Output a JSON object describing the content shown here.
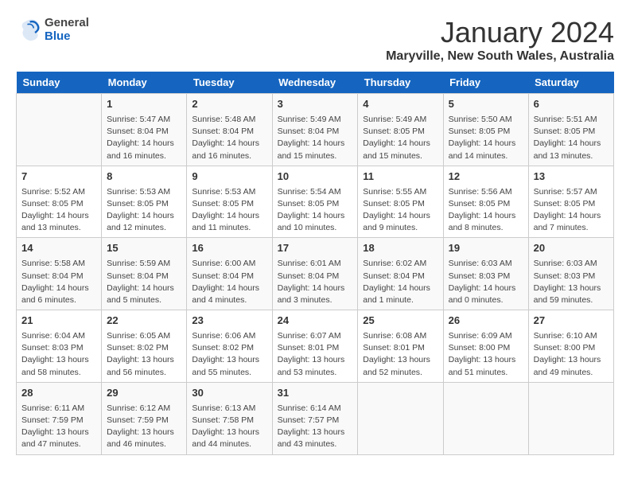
{
  "header": {
    "logo_general": "General",
    "logo_blue": "Blue",
    "month": "January 2024",
    "location": "Maryville, New South Wales, Australia"
  },
  "days_of_week": [
    "Sunday",
    "Monday",
    "Tuesday",
    "Wednesday",
    "Thursday",
    "Friday",
    "Saturday"
  ],
  "weeks": [
    [
      {
        "day": "",
        "info": ""
      },
      {
        "day": "1",
        "info": "Sunrise: 5:47 AM\nSunset: 8:04 PM\nDaylight: 14 hours\nand 16 minutes."
      },
      {
        "day": "2",
        "info": "Sunrise: 5:48 AM\nSunset: 8:04 PM\nDaylight: 14 hours\nand 16 minutes."
      },
      {
        "day": "3",
        "info": "Sunrise: 5:49 AM\nSunset: 8:04 PM\nDaylight: 14 hours\nand 15 minutes."
      },
      {
        "day": "4",
        "info": "Sunrise: 5:49 AM\nSunset: 8:05 PM\nDaylight: 14 hours\nand 15 minutes."
      },
      {
        "day": "5",
        "info": "Sunrise: 5:50 AM\nSunset: 8:05 PM\nDaylight: 14 hours\nand 14 minutes."
      },
      {
        "day": "6",
        "info": "Sunrise: 5:51 AM\nSunset: 8:05 PM\nDaylight: 14 hours\nand 13 minutes."
      }
    ],
    [
      {
        "day": "7",
        "info": "Sunrise: 5:52 AM\nSunset: 8:05 PM\nDaylight: 14 hours\nand 13 minutes."
      },
      {
        "day": "8",
        "info": "Sunrise: 5:53 AM\nSunset: 8:05 PM\nDaylight: 14 hours\nand 12 minutes."
      },
      {
        "day": "9",
        "info": "Sunrise: 5:53 AM\nSunset: 8:05 PM\nDaylight: 14 hours\nand 11 minutes."
      },
      {
        "day": "10",
        "info": "Sunrise: 5:54 AM\nSunset: 8:05 PM\nDaylight: 14 hours\nand 10 minutes."
      },
      {
        "day": "11",
        "info": "Sunrise: 5:55 AM\nSunset: 8:05 PM\nDaylight: 14 hours\nand 9 minutes."
      },
      {
        "day": "12",
        "info": "Sunrise: 5:56 AM\nSunset: 8:05 PM\nDaylight: 14 hours\nand 8 minutes."
      },
      {
        "day": "13",
        "info": "Sunrise: 5:57 AM\nSunset: 8:05 PM\nDaylight: 14 hours\nand 7 minutes."
      }
    ],
    [
      {
        "day": "14",
        "info": "Sunrise: 5:58 AM\nSunset: 8:04 PM\nDaylight: 14 hours\nand 6 minutes."
      },
      {
        "day": "15",
        "info": "Sunrise: 5:59 AM\nSunset: 8:04 PM\nDaylight: 14 hours\nand 5 minutes."
      },
      {
        "day": "16",
        "info": "Sunrise: 6:00 AM\nSunset: 8:04 PM\nDaylight: 14 hours\nand 4 minutes."
      },
      {
        "day": "17",
        "info": "Sunrise: 6:01 AM\nSunset: 8:04 PM\nDaylight: 14 hours\nand 3 minutes."
      },
      {
        "day": "18",
        "info": "Sunrise: 6:02 AM\nSunset: 8:04 PM\nDaylight: 14 hours\nand 1 minute."
      },
      {
        "day": "19",
        "info": "Sunrise: 6:03 AM\nSunset: 8:03 PM\nDaylight: 14 hours\nand 0 minutes."
      },
      {
        "day": "20",
        "info": "Sunrise: 6:03 AM\nSunset: 8:03 PM\nDaylight: 13 hours\nand 59 minutes."
      }
    ],
    [
      {
        "day": "21",
        "info": "Sunrise: 6:04 AM\nSunset: 8:03 PM\nDaylight: 13 hours\nand 58 minutes."
      },
      {
        "day": "22",
        "info": "Sunrise: 6:05 AM\nSunset: 8:02 PM\nDaylight: 13 hours\nand 56 minutes."
      },
      {
        "day": "23",
        "info": "Sunrise: 6:06 AM\nSunset: 8:02 PM\nDaylight: 13 hours\nand 55 minutes."
      },
      {
        "day": "24",
        "info": "Sunrise: 6:07 AM\nSunset: 8:01 PM\nDaylight: 13 hours\nand 53 minutes."
      },
      {
        "day": "25",
        "info": "Sunrise: 6:08 AM\nSunset: 8:01 PM\nDaylight: 13 hours\nand 52 minutes."
      },
      {
        "day": "26",
        "info": "Sunrise: 6:09 AM\nSunset: 8:00 PM\nDaylight: 13 hours\nand 51 minutes."
      },
      {
        "day": "27",
        "info": "Sunrise: 6:10 AM\nSunset: 8:00 PM\nDaylight: 13 hours\nand 49 minutes."
      }
    ],
    [
      {
        "day": "28",
        "info": "Sunrise: 6:11 AM\nSunset: 7:59 PM\nDaylight: 13 hours\nand 47 minutes."
      },
      {
        "day": "29",
        "info": "Sunrise: 6:12 AM\nSunset: 7:59 PM\nDaylight: 13 hours\nand 46 minutes."
      },
      {
        "day": "30",
        "info": "Sunrise: 6:13 AM\nSunset: 7:58 PM\nDaylight: 13 hours\nand 44 minutes."
      },
      {
        "day": "31",
        "info": "Sunrise: 6:14 AM\nSunset: 7:57 PM\nDaylight: 13 hours\nand 43 minutes."
      },
      {
        "day": "",
        "info": ""
      },
      {
        "day": "",
        "info": ""
      },
      {
        "day": "",
        "info": ""
      }
    ]
  ]
}
